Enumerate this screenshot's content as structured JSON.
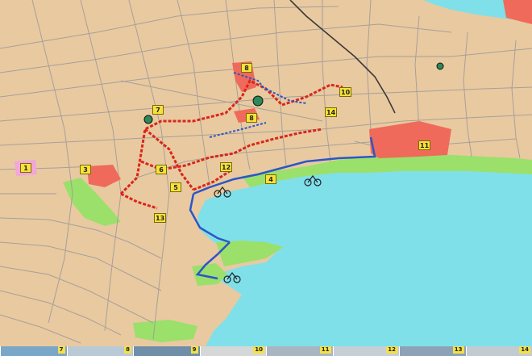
{
  "colors": {
    "land": "#e9c9a0",
    "sea": "#7fe0ea",
    "park": "#9be06a",
    "district": "#ef6a5a",
    "route_red": "#d9261c",
    "route_blue": "#2b56c8",
    "roads": "#8a8a8a",
    "labels_bg": "#f6e23a"
  },
  "markers": [
    {
      "id": "1",
      "label": "1"
    },
    {
      "id": "3",
      "label": "3"
    },
    {
      "id": "4",
      "label": "4"
    },
    {
      "id": "5",
      "label": "5"
    },
    {
      "id": "6",
      "label": "6"
    },
    {
      "id": "7",
      "label": "7"
    },
    {
      "id": "8a",
      "label": "8"
    },
    {
      "id": "8b",
      "label": "8"
    },
    {
      "id": "10",
      "label": "10"
    },
    {
      "id": "11",
      "label": "11"
    },
    {
      "id": "12",
      "label": "12"
    },
    {
      "id": "13",
      "label": "13"
    },
    {
      "id": "14",
      "label": "14"
    }
  ],
  "thumbnails": [
    {
      "label": "7"
    },
    {
      "label": "8"
    },
    {
      "label": "9"
    },
    {
      "label": "10"
    },
    {
      "label": "11"
    },
    {
      "label": "12"
    },
    {
      "label": "13"
    },
    {
      "label": "14"
    }
  ]
}
